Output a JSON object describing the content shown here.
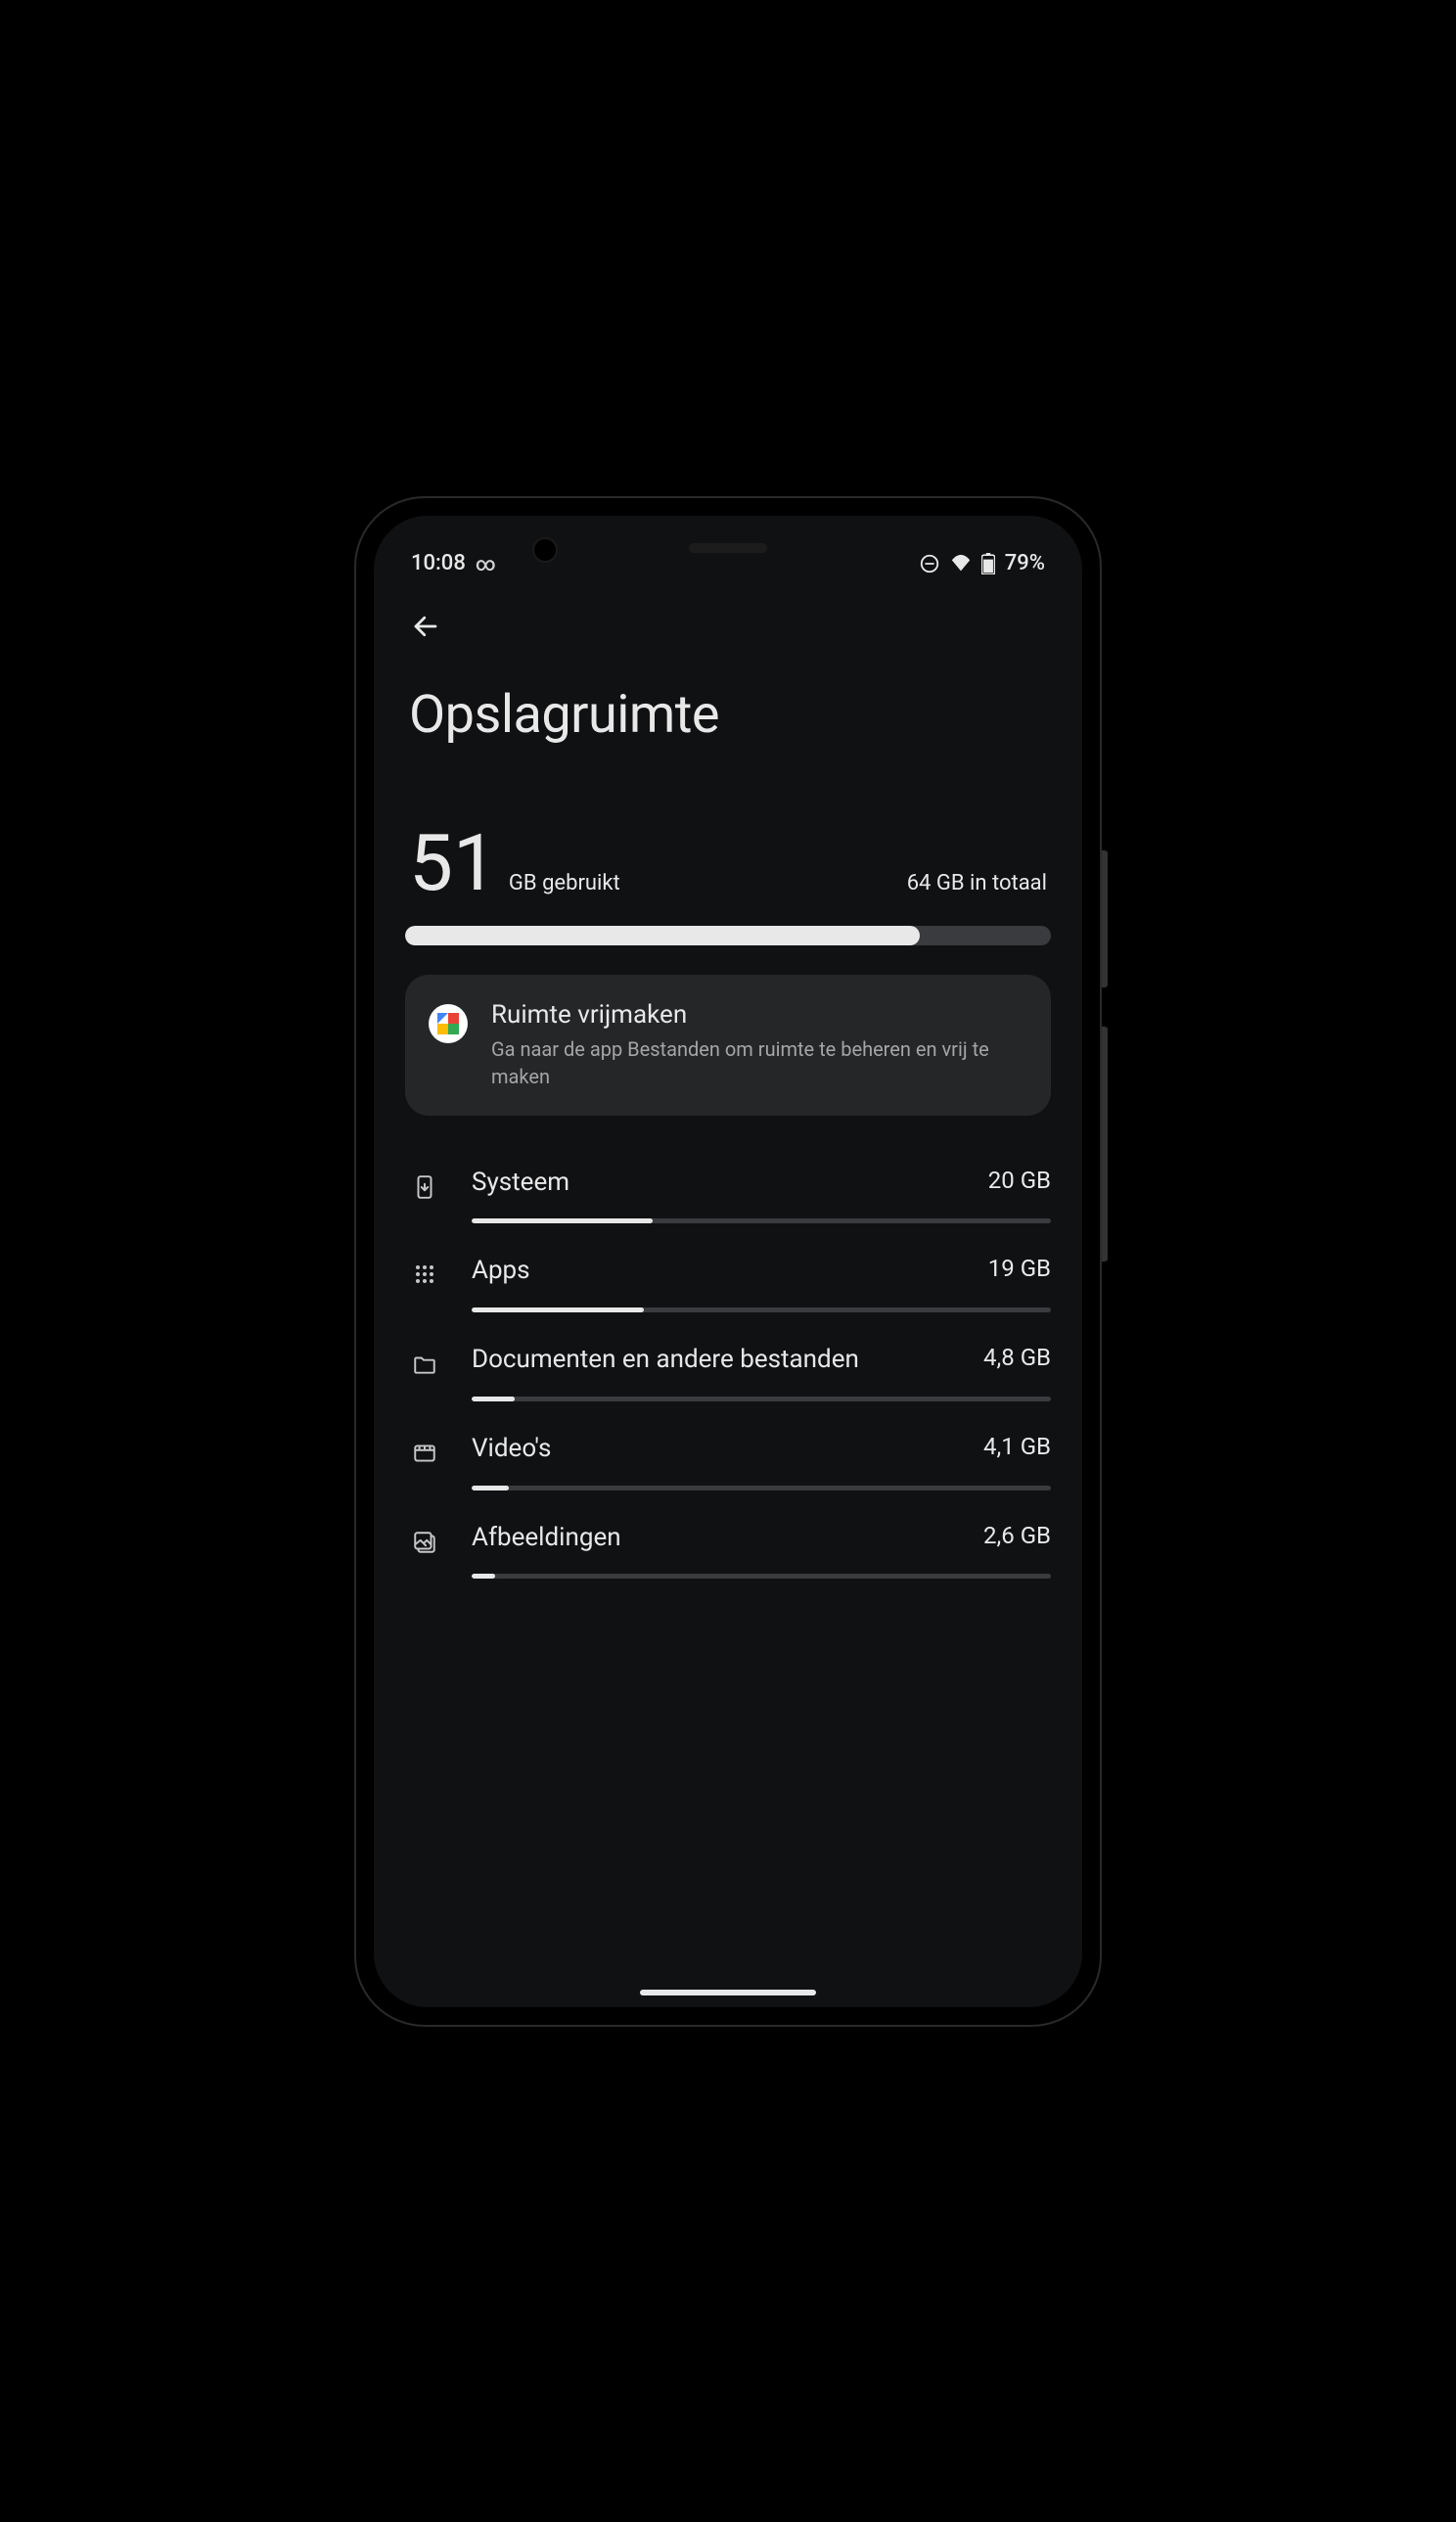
{
  "status_bar": {
    "time": "10:08",
    "battery_text": "79%"
  },
  "page": {
    "title": "Opslagruimte"
  },
  "usage": {
    "used_value": "51",
    "used_label": "GB gebruikt",
    "total_label": "64 GB in totaal",
    "percent_used": 79.7
  },
  "card": {
    "title": "Ruimte vrijmaken",
    "subtitle": "Ga naar de app Bestanden om ruimte te beheren en vrij te maken"
  },
  "categories": [
    {
      "id": "systeem",
      "label": "Systeem",
      "size": "20 GB",
      "pct": 31.3
    },
    {
      "id": "apps",
      "label": "Apps",
      "size": "19 GB",
      "pct": 29.7
    },
    {
      "id": "documenten",
      "label": "Documenten en andere bestanden",
      "size": "4,8 GB",
      "pct": 7.5
    },
    {
      "id": "videos",
      "label": "Video's",
      "size": "4,1 GB",
      "pct": 6.4
    },
    {
      "id": "afbeeldingen",
      "label": "Afbeeldingen",
      "size": "2,6 GB",
      "pct": 4.1
    }
  ]
}
